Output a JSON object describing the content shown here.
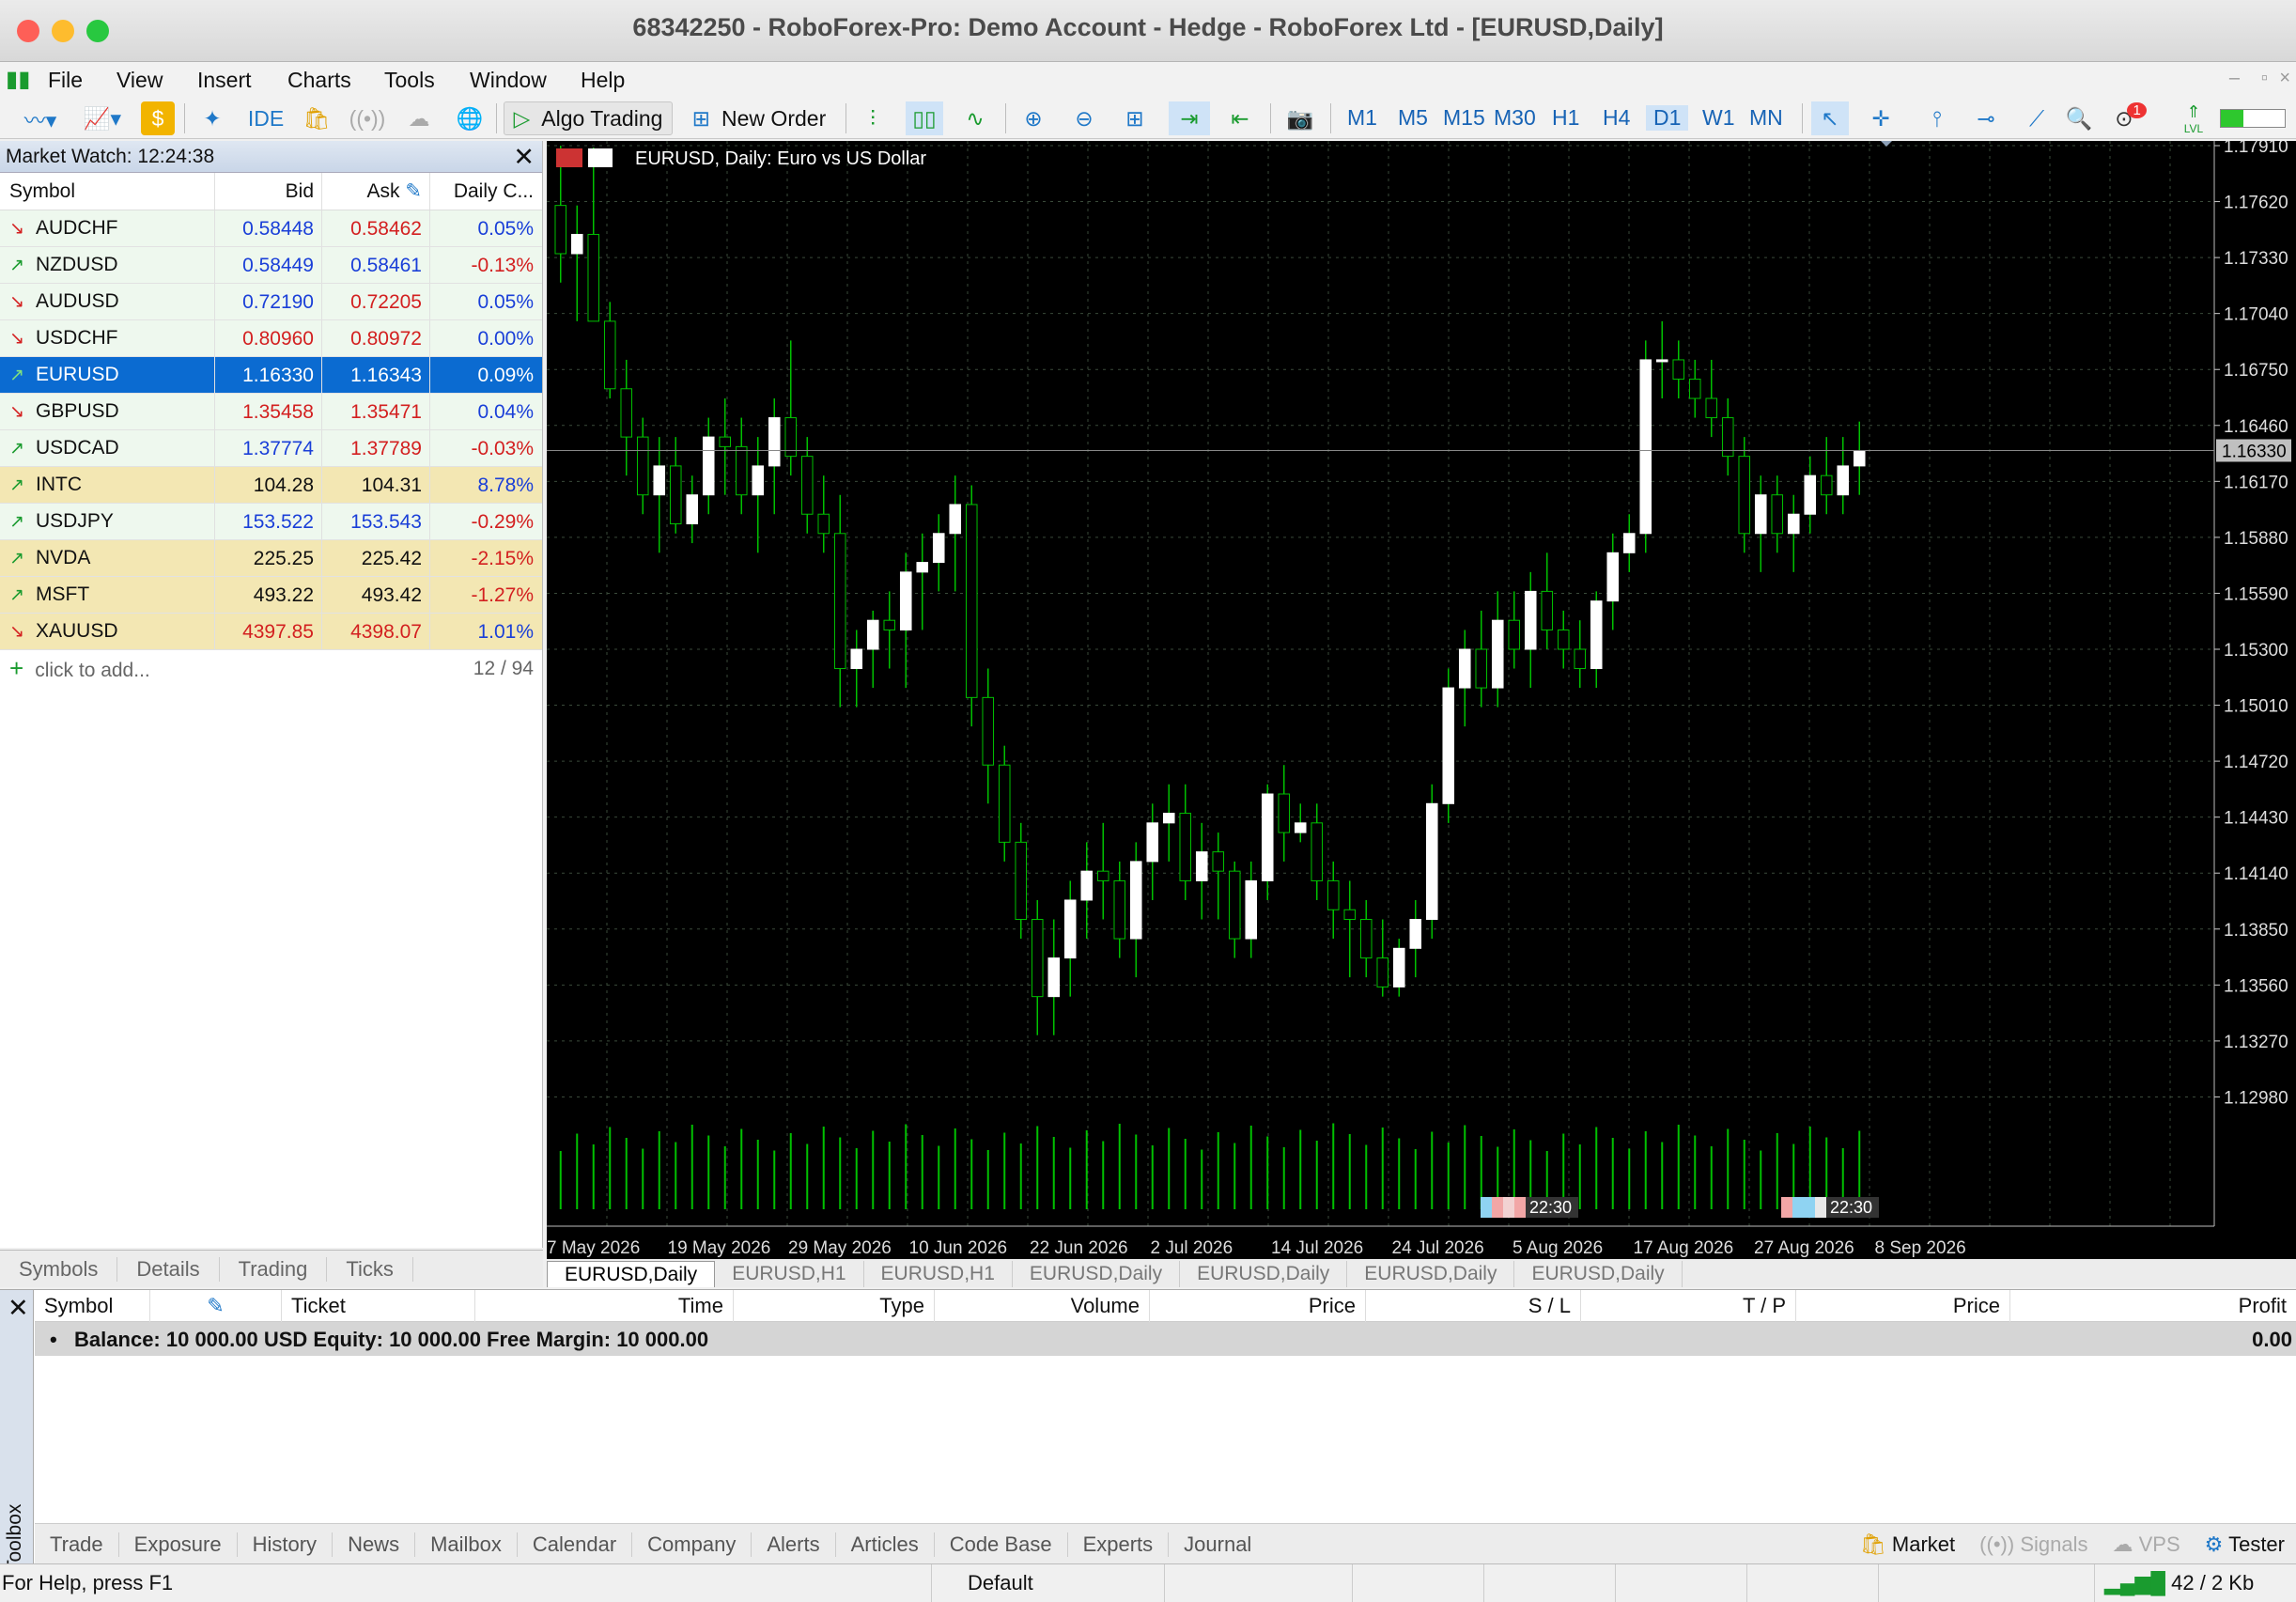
{
  "window": {
    "title": "68342250 - RoboForex-Pro: Demo Account - Hedge - RoboForex Ltd - [EURUSD,Daily]"
  },
  "menu": [
    "File",
    "View",
    "Insert",
    "Charts",
    "Tools",
    "Window",
    "Help"
  ],
  "toolbar": {
    "ide_label": "IDE",
    "algo_label": "Algo Trading",
    "new_order_label": "New Order",
    "timeframes": [
      "M1",
      "M5",
      "M15",
      "M30",
      "H1",
      "H4",
      "D1",
      "W1",
      "MN"
    ],
    "active_timeframe": "D1",
    "notif_count": "1",
    "lvl_label": "LVL"
  },
  "market_watch": {
    "title": "Market Watch: 12:24:38",
    "columns": [
      "Symbol",
      "Bid",
      "Ask",
      "Daily C..."
    ],
    "rows": [
      {
        "symbol": "AUDCHF",
        "bid": "0.58448",
        "ask": "0.58462",
        "change": "0.05%",
        "dir": "down",
        "kind": "fx",
        "bidc": "#1a3fd8",
        "askc": "#d32020",
        "chgc": "#1a3fd8"
      },
      {
        "symbol": "NZDUSD",
        "bid": "0.58449",
        "ask": "0.58461",
        "change": "-0.13%",
        "dir": "up",
        "kind": "fx",
        "bidc": "#1a3fd8",
        "askc": "#1a3fd8",
        "chgc": "#d32020"
      },
      {
        "symbol": "AUDUSD",
        "bid": "0.72190",
        "ask": "0.72205",
        "change": "0.05%",
        "dir": "down",
        "kind": "fx",
        "bidc": "#1a3fd8",
        "askc": "#d32020",
        "chgc": "#1a3fd8"
      },
      {
        "symbol": "USDCHF",
        "bid": "0.80960",
        "ask": "0.80972",
        "change": "0.00%",
        "dir": "down",
        "kind": "fx",
        "bidc": "#d32020",
        "askc": "#d32020",
        "chgc": "#1a3fd8"
      },
      {
        "symbol": "EURUSD",
        "bid": "1.16330",
        "ask": "1.16343",
        "change": "0.09%",
        "dir": "up",
        "kind": "sel",
        "bidc": "#fff",
        "askc": "#fff",
        "chgc": "#fff"
      },
      {
        "symbol": "GBPUSD",
        "bid": "1.35458",
        "ask": "1.35471",
        "change": "0.04%",
        "dir": "down",
        "kind": "fx",
        "bidc": "#d32020",
        "askc": "#d32020",
        "chgc": "#1a3fd8"
      },
      {
        "symbol": "USDCAD",
        "bid": "1.37774",
        "ask": "1.37789",
        "change": "-0.03%",
        "dir": "up",
        "kind": "fx",
        "bidc": "#1a3fd8",
        "askc": "#d32020",
        "chgc": "#d32020"
      },
      {
        "symbol": "INTC",
        "bid": "104.28",
        "ask": "104.31",
        "change": "8.78%",
        "dir": "up",
        "kind": "stk",
        "bidc": "#111",
        "askc": "#111",
        "chgc": "#1a3fd8"
      },
      {
        "symbol": "USDJPY",
        "bid": "153.522",
        "ask": "153.543",
        "change": "-0.29%",
        "dir": "up",
        "kind": "fx",
        "bidc": "#1a3fd8",
        "askc": "#1a3fd8",
        "chgc": "#d32020"
      },
      {
        "symbol": "NVDA",
        "bid": "225.25",
        "ask": "225.42",
        "change": "-2.15%",
        "dir": "up",
        "kind": "stk",
        "bidc": "#111",
        "askc": "#111",
        "chgc": "#d32020"
      },
      {
        "symbol": "MSFT",
        "bid": "493.22",
        "ask": "493.42",
        "change": "-1.27%",
        "dir": "up",
        "kind": "stk",
        "bidc": "#111",
        "askc": "#111",
        "chgc": "#d32020"
      },
      {
        "symbol": "XAUUSD",
        "bid": "4397.85",
        "ask": "4398.07",
        "change": "1.01%",
        "dir": "down",
        "kind": "stk",
        "bidc": "#d32020",
        "askc": "#d32020",
        "chgc": "#1a3fd8"
      }
    ],
    "add_label": "click to add...",
    "count": "12 / 94",
    "tabs": [
      "Symbols",
      "Details",
      "Trading",
      "Ticks"
    ]
  },
  "chart": {
    "header": "EURUSD, Daily:  Euro vs US Dollar",
    "current_price": "1.16330",
    "price_ticks": [
      "1.17910",
      "1.17620",
      "1.17330",
      "1.17040",
      "1.16750",
      "1.16460",
      "1.16170",
      "1.15880",
      "1.15590",
      "1.15300",
      "1.15010",
      "1.14720",
      "1.14430",
      "1.14140",
      "1.13850",
      "1.13560",
      "1.13270",
      "1.12980"
    ],
    "date_ticks": [
      "7 May 2026",
      "19 May 2026",
      "29 May 2026",
      "10 Jun 2026",
      "22 Jun 2026",
      "2 Jul 2026",
      "14 Jul 2026",
      "24 Jul 2026",
      "5 Aug 2026",
      "17 Aug 2026",
      "27 Aug 2026",
      "8 Sep 2026"
    ],
    "event_time_1": "22:30",
    "event_time_2": "22:30",
    "tabs": [
      "EURUSD,Daily",
      "EURUSD,H1",
      "EURUSD,H1",
      "EURUSD,Daily",
      "EURUSD,Daily",
      "EURUSD,Daily",
      "EURUSD,Daily"
    ],
    "colors": {
      "bull": "#ffffff",
      "bear": "#000000",
      "wick": "#00c000",
      "grid": "#3a4a3a"
    }
  },
  "chart_data": {
    "type": "candlestick",
    "title": "EURUSD, Daily:  Euro vs US Dollar",
    "ylim": [
      1.1269,
      1.1791
    ],
    "ohlc": [
      [
        1.176,
        1.1791,
        1.172,
        1.1735
      ],
      [
        1.1735,
        1.176,
        1.17,
        1.1745
      ],
      [
        1.1745,
        1.179,
        1.17,
        1.17
      ],
      [
        1.17,
        1.171,
        1.166,
        1.1665
      ],
      [
        1.1665,
        1.168,
        1.162,
        1.164
      ],
      [
        1.164,
        1.165,
        1.16,
        1.161
      ],
      [
        1.161,
        1.164,
        1.158,
        1.1625
      ],
      [
        1.1625,
        1.164,
        1.159,
        1.1595
      ],
      [
        1.1595,
        1.162,
        1.1585,
        1.161
      ],
      [
        1.161,
        1.165,
        1.16,
        1.164
      ],
      [
        1.164,
        1.166,
        1.161,
        1.1635
      ],
      [
        1.1635,
        1.165,
        1.16,
        1.161
      ],
      [
        1.161,
        1.164,
        1.158,
        1.1625
      ],
      [
        1.1625,
        1.166,
        1.16,
        1.165
      ],
      [
        1.165,
        1.169,
        1.162,
        1.163
      ],
      [
        1.163,
        1.164,
        1.159,
        1.16
      ],
      [
        1.16,
        1.162,
        1.158,
        1.159
      ],
      [
        1.159,
        1.161,
        1.15,
        1.152
      ],
      [
        1.152,
        1.154,
        1.15,
        1.153
      ],
      [
        1.153,
        1.155,
        1.151,
        1.1545
      ],
      [
        1.1545,
        1.156,
        1.152,
        1.154
      ],
      [
        1.154,
        1.158,
        1.151,
        1.157
      ],
      [
        1.157,
        1.159,
        1.154,
        1.1575
      ],
      [
        1.1575,
        1.16,
        1.156,
        1.159
      ],
      [
        1.159,
        1.162,
        1.156,
        1.1605
      ],
      [
        1.1605,
        1.1615,
        1.149,
        1.1505
      ],
      [
        1.1505,
        1.152,
        1.145,
        1.147
      ],
      [
        1.147,
        1.148,
        1.142,
        1.143
      ],
      [
        1.143,
        1.144,
        1.138,
        1.139
      ],
      [
        1.139,
        1.14,
        1.133,
        1.135
      ],
      [
        1.135,
        1.139,
        1.133,
        1.137
      ],
      [
        1.137,
        1.141,
        1.135,
        1.14
      ],
      [
        1.14,
        1.143,
        1.138,
        1.1415
      ],
      [
        1.1415,
        1.144,
        1.139,
        1.141
      ],
      [
        1.141,
        1.142,
        1.137,
        1.138
      ],
      [
        1.138,
        1.143,
        1.136,
        1.142
      ],
      [
        1.142,
        1.145,
        1.14,
        1.144
      ],
      [
        1.144,
        1.146,
        1.142,
        1.1445
      ],
      [
        1.1445,
        1.146,
        1.14,
        1.141
      ],
      [
        1.141,
        1.144,
        1.139,
        1.1425
      ],
      [
        1.1425,
        1.1435,
        1.139,
        1.1415
      ],
      [
        1.1415,
        1.142,
        1.137,
        1.138
      ],
      [
        1.138,
        1.142,
        1.137,
        1.141
      ],
      [
        1.141,
        1.146,
        1.14,
        1.1455
      ],
      [
        1.1455,
        1.147,
        1.142,
        1.1435
      ],
      [
        1.1435,
        1.145,
        1.143,
        1.144
      ],
      [
        1.144,
        1.145,
        1.14,
        1.141
      ],
      [
        1.141,
        1.142,
        1.138,
        1.1395
      ],
      [
        1.1395,
        1.141,
        1.136,
        1.139
      ],
      [
        1.139,
        1.14,
        1.136,
        1.137
      ],
      [
        1.137,
        1.139,
        1.135,
        1.1355
      ],
      [
        1.1355,
        1.138,
        1.135,
        1.1375
      ],
      [
        1.1375,
        1.14,
        1.136,
        1.139
      ],
      [
        1.139,
        1.146,
        1.138,
        1.145
      ],
      [
        1.145,
        1.152,
        1.144,
        1.151
      ],
      [
        1.151,
        1.154,
        1.149,
        1.153
      ],
      [
        1.153,
        1.155,
        1.15,
        1.151
      ],
      [
        1.151,
        1.156,
        1.15,
        1.1545
      ],
      [
        1.1545,
        1.156,
        1.152,
        1.153
      ],
      [
        1.153,
        1.157,
        1.151,
        1.156
      ],
      [
        1.156,
        1.158,
        1.153,
        1.154
      ],
      [
        1.154,
        1.155,
        1.152,
        1.153
      ],
      [
        1.153,
        1.1545,
        1.151,
        1.152
      ],
      [
        1.152,
        1.156,
        1.151,
        1.1555
      ],
      [
        1.1555,
        1.159,
        1.154,
        1.158
      ],
      [
        1.158,
        1.16,
        1.157,
        1.159
      ],
      [
        1.159,
        1.169,
        1.158,
        1.168
      ],
      [
        1.168,
        1.17,
        1.166,
        1.168
      ],
      [
        1.168,
        1.169,
        1.166,
        1.167
      ],
      [
        1.167,
        1.168,
        1.165,
        1.166
      ],
      [
        1.166,
        1.168,
        1.164,
        1.165
      ],
      [
        1.165,
        1.166,
        1.162,
        1.163
      ],
      [
        1.163,
        1.164,
        1.158,
        1.159
      ],
      [
        1.159,
        1.162,
        1.157,
        1.161
      ],
      [
        1.161,
        1.162,
        1.158,
        1.159
      ],
      [
        1.159,
        1.161,
        1.157,
        1.16
      ],
      [
        1.16,
        1.163,
        1.159,
        1.162
      ],
      [
        1.162,
        1.164,
        1.16,
        1.161
      ],
      [
        1.161,
        1.164,
        1.16,
        1.1625
      ],
      [
        1.1625,
        1.1648,
        1.161,
        1.1633
      ]
    ]
  },
  "toolbox": {
    "columns": [
      "Symbol",
      "Ticket",
      "Time",
      "Type",
      "Volume",
      "Price",
      "S / L",
      "T / P",
      "Price",
      "Profit"
    ],
    "balance_line": "Balance: 10 000.00 USD  Equity: 10 000.00  Free Margin: 10 000.00",
    "profit": "0.00",
    "side_label": "Toolbox",
    "tabs": [
      "Trade",
      "Exposure",
      "History",
      "News",
      "Mailbox",
      "Calendar",
      "Company",
      "Alerts",
      "Articles",
      "Code Base",
      "Experts",
      "Journal"
    ],
    "right_items": [
      "Market",
      "Signals",
      "VPS",
      "Tester"
    ]
  },
  "status": {
    "help": "For Help, press F1",
    "profile": "Default",
    "traffic": "42 / 2 Kb"
  }
}
